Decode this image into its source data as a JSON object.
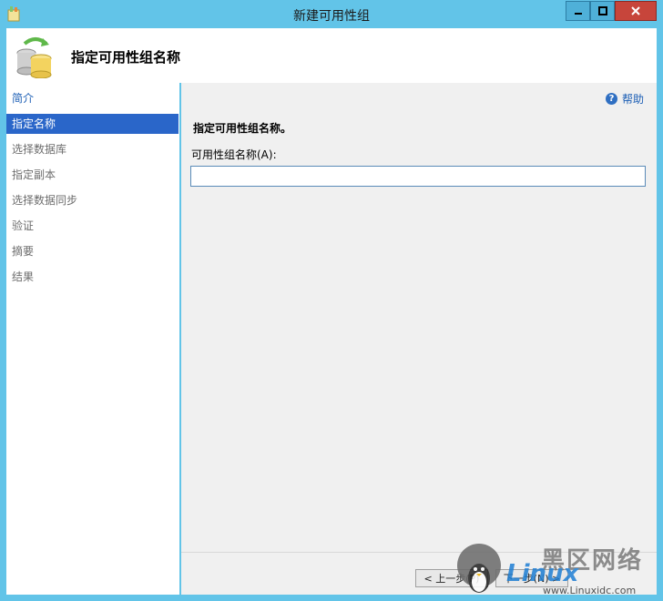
{
  "window": {
    "title": "新建可用性组"
  },
  "header": {
    "title": "指定可用性组名称"
  },
  "nav": {
    "items": [
      {
        "label": "简介"
      },
      {
        "label": "指定名称"
      },
      {
        "label": "选择数据库"
      },
      {
        "label": "指定副本"
      },
      {
        "label": "选择数据同步"
      },
      {
        "label": "验证"
      },
      {
        "label": "摘要"
      },
      {
        "label": "结果"
      }
    ]
  },
  "content": {
    "help_label": "帮助",
    "section_title": "指定可用性组名称。",
    "field_label": "可用性组名称(A):",
    "field_value": ""
  },
  "footer": {
    "prev_label": "< 上一步(P)",
    "next_label": "下一步(N) >"
  },
  "watermark": {
    "text": "黑区网络",
    "brand": "Linux",
    "url": "www.Linuxidc.com"
  },
  "colors": {
    "frame": "#62c4e8",
    "nav_active": "#2a66c9",
    "link": "#1d5fb5",
    "close_button": "#c7453b"
  }
}
